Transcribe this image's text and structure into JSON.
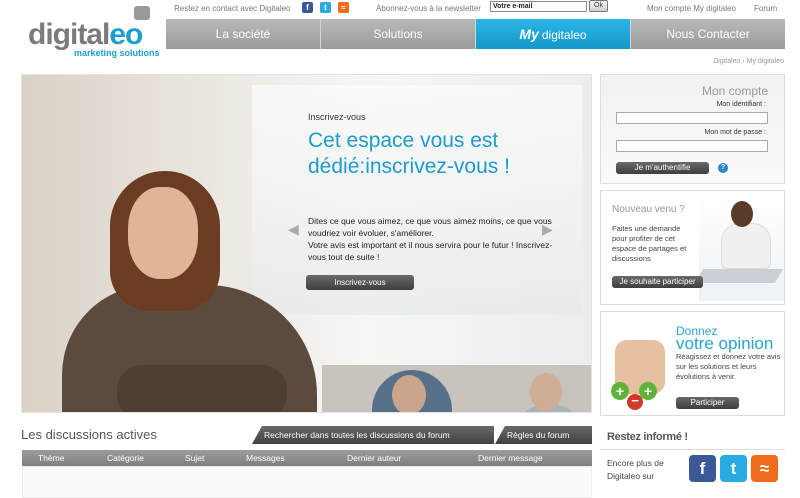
{
  "topbar": {
    "contact": "Restez en contact avec Digitaleo",
    "social": [
      {
        "name": "facebook",
        "glyph": "f",
        "color": "#3b5998"
      },
      {
        "name": "twitter",
        "glyph": "t",
        "color": "#29aae1"
      },
      {
        "name": "rss",
        "glyph": "≈",
        "color": "#f06a1b"
      }
    ],
    "newsletter_label": "Abonnez-vous à la newsletter",
    "newsletter_value": "Votre e-mail",
    "ok": "Ok",
    "account": "Mon compte My digitaleo",
    "forum": "Forum"
  },
  "logo": {
    "word_a": "digital",
    "word_b": "eo",
    "tagline": "marketing solutions"
  },
  "nav": {
    "items": [
      {
        "label": "La société"
      },
      {
        "label": "Solutions"
      },
      {
        "my": "My",
        "label": "digitaleo"
      },
      {
        "label": "Nous Contacter"
      }
    ],
    "active_color": "#1e9ccc"
  },
  "breadcrumb": "Digitaleo  ›  My digitaleo",
  "hero": {
    "eyebrow": "Inscrivez-vous",
    "title": "Cet espace vous est dédié:inscrivez-vous !",
    "body_1": "Dites ce que vous aimez, ce que vous aimez moins, ce que vous voudriez voir évoluer, s'améliorer.",
    "body_2": "Votre avis est important et il nous servira pour le futur ! Inscrivez-vous tout de suite !",
    "button": "Inscrivez-vous",
    "prev": "◀",
    "next": "▶"
  },
  "account": {
    "title": "Mon compte",
    "id_label": "Mon identifiant :",
    "pw_label": "Mon mot de passe :",
    "button": "Je m'authentifie",
    "help": "?"
  },
  "newcomer": {
    "title": "Nouveau venu ?",
    "text": "Faites une demande pour profiter de cet espace de partages et discussions",
    "button": "Je souhaite participer"
  },
  "opinion": {
    "title_1": "Donnez",
    "title_2": "votre opinion",
    "text": "Réagissez et donnez votre avis sur les solutions et leurs évolutions à venir.",
    "button": "Participer"
  },
  "discussions": {
    "title": "Les discussions actives",
    "search_tab": "Rechercher dans toutes les discussions du forum",
    "rules_tab": "Règles du forum",
    "columns": [
      "Thème",
      "Catégorie",
      "Sujet",
      "Messages",
      "Dernier auteur",
      "Dernier message"
    ]
  },
  "informed": {
    "title": "Restez informé !",
    "text": "Encore plus de Digitaleo sur"
  }
}
